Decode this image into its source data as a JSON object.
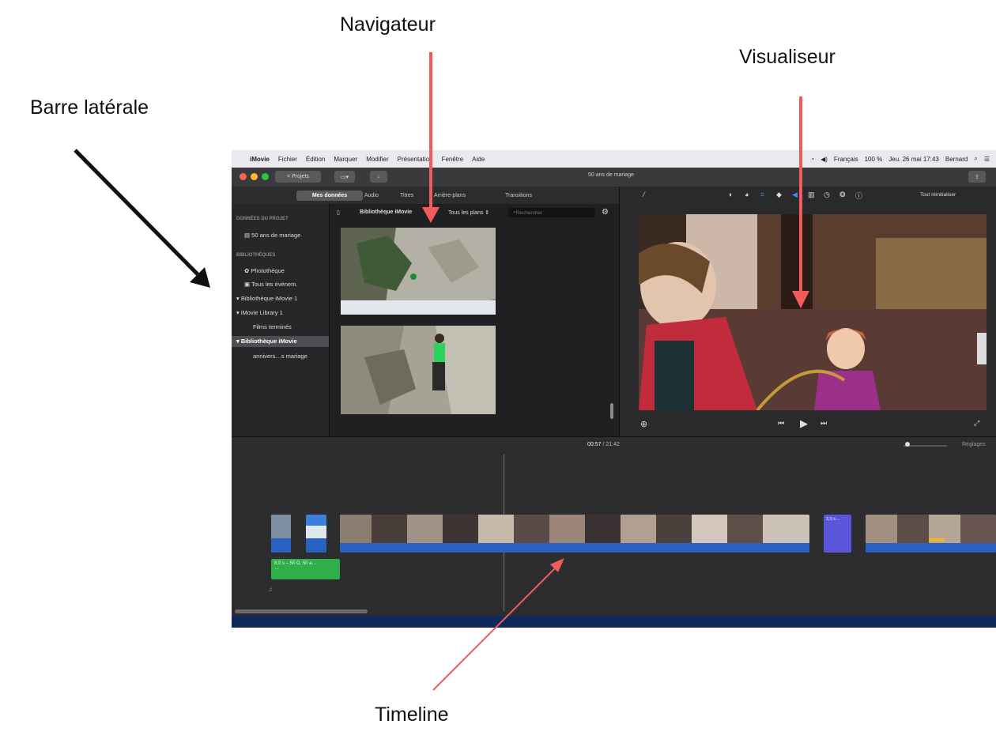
{
  "callouts": {
    "navigateur": "Navigateur",
    "visualiseur": "Visualiseur",
    "barre_laterale": "Barre latérale",
    "timeline": "Timeline"
  },
  "menubar": {
    "app": "iMovie",
    "items": [
      "Fichier",
      "Édition",
      "Marquer",
      "Modifier",
      "Présentation",
      "Fenêtre",
      "Aide"
    ],
    "input_lang": "Français",
    "battery": "100 %",
    "clock": "Jeu. 26 mai 17:43",
    "user": "Bernard"
  },
  "toolbar": {
    "back_label": "< Projets",
    "window_title": "50 ans de mariage"
  },
  "tabs": [
    "Mes données",
    "Audio",
    "Titres",
    "Arrière-plans",
    "Transitions"
  ],
  "sidebar": {
    "section_project": "DONNÉES DU PROJET",
    "project": "50 ans de mariage",
    "section_libraries": "BIBLIOTHÈQUES",
    "phototheque": "Photothèque",
    "all_events": "Tous les événem.",
    "lib1": "▾ Bibliothèque iMovie 1",
    "lib2": "▾ iMovie Library 1",
    "films": "Films terminés",
    "lib3": "▾ Bibliothèque iMovie",
    "event": "annivers…s mariage"
  },
  "browser": {
    "library_label": "Bibliothèque iMovie",
    "filter": "Tous les plans",
    "search_placeholder": "Rechercher"
  },
  "viewer": {
    "reset": "Tout réinitialiser"
  },
  "timeline": {
    "timecode": "00:57",
    "duration": "21:42",
    "settings": "Réglages",
    "green_clip_line1": "8,0 s – 50 Ω, 50 a…",
    "green_clip_line2": "…",
    "purple_clip": "3,0 s…"
  }
}
